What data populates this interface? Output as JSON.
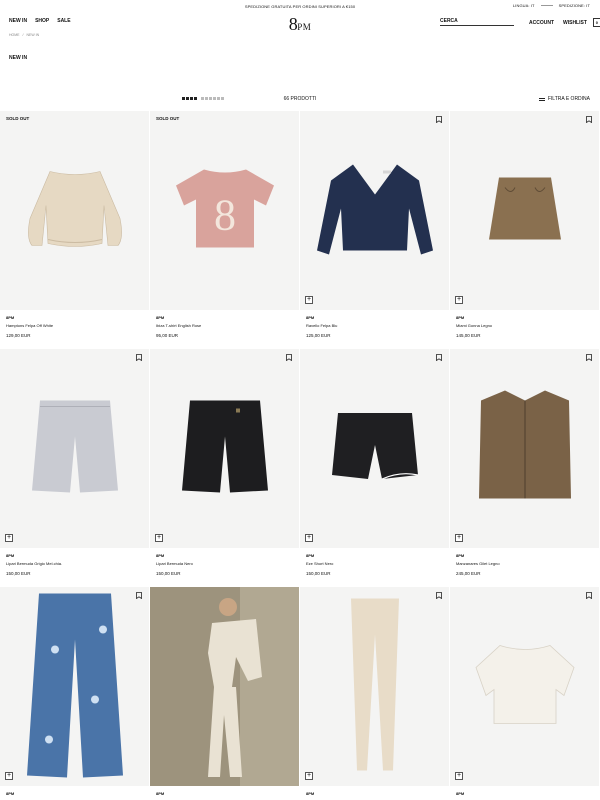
{
  "announcement": {
    "text": "SPEDIZIONE GRATUITA PER ORDINI SUPERIORI A €150",
    "language": "LINGUA: IT",
    "shipping": "SPEDIZIONE: IT"
  },
  "header": {
    "nav": [
      "NEW IN",
      "SHOP",
      "SALE"
    ],
    "logo_main": "8",
    "logo_sub": "PM",
    "search_label": "CERCA",
    "account": "ACCOUNT",
    "wishlist": "WISHLIST",
    "bag_count": "0"
  },
  "breadcrumb": [
    "HOME",
    "NEW IN"
  ],
  "page_title": "NEW IN",
  "toolbar": {
    "count": "66 PRODOTTI",
    "filter": "FILTRA E ORDINA"
  },
  "products": [
    {
      "brand": "8PM",
      "name": "Hamptons Felpa Off White",
      "price": "129,00 EUR",
      "badge": "SOLD OUT",
      "icon": "sweatshirt",
      "color": "#e6d9c3"
    },
    {
      "brand": "8PM",
      "name": "Ibiza T-shirt English Rose",
      "price": "95,00 EUR",
      "badge": "SOLD OUT",
      "icon": "tshirt",
      "color": "#d9a39c"
    },
    {
      "brand": "8PM",
      "name": "Ravello Felpa Blu",
      "price": "125,00 EUR",
      "badge": "",
      "icon": "sweater",
      "color": "#23304f"
    },
    {
      "brand": "8PM",
      "name": "Miami Gonna Legno",
      "price": "145,00 EUR",
      "badge": "",
      "icon": "skirt",
      "color": "#8a7050"
    },
    {
      "brand": "8PM",
      "name": "Lipari Bermuda Grigio Mel.chia.",
      "price": "150,00 EUR",
      "badge": "",
      "icon": "bermuda",
      "color": "#c9cbd2"
    },
    {
      "brand": "8PM",
      "name": "Lipari Bermuda Nero",
      "price": "150,00 EUR",
      "badge": "",
      "icon": "bermuda-black",
      "color": "#1d1d1f"
    },
    {
      "brand": "8PM",
      "name": "Eze Short Nero",
      "price": "150,00 EUR",
      "badge": "",
      "icon": "shorts",
      "color": "#1f1f22"
    },
    {
      "brand": "8PM",
      "name": "Manzanares Gilet Legno",
      "price": "245,00 EUR",
      "badge": "",
      "icon": "vest",
      "color": "#7a6247"
    },
    {
      "brand": "8PM",
      "name": "",
      "price": "",
      "badge": "",
      "icon": "pants-blue",
      "color": "#4a74a8"
    },
    {
      "brand": "8PM",
      "name": "",
      "price": "",
      "badge": "",
      "icon": "model-photo",
      "color": "#e9e2d3"
    },
    {
      "brand": "8PM",
      "name": "",
      "price": "",
      "badge": "",
      "icon": "leggings",
      "color": "#e8dcc8"
    },
    {
      "brand": "8PM",
      "name": "",
      "price": "",
      "badge": "",
      "icon": "top-white",
      "color": "#f4f1ea"
    }
  ],
  "plus_symbol": "+"
}
